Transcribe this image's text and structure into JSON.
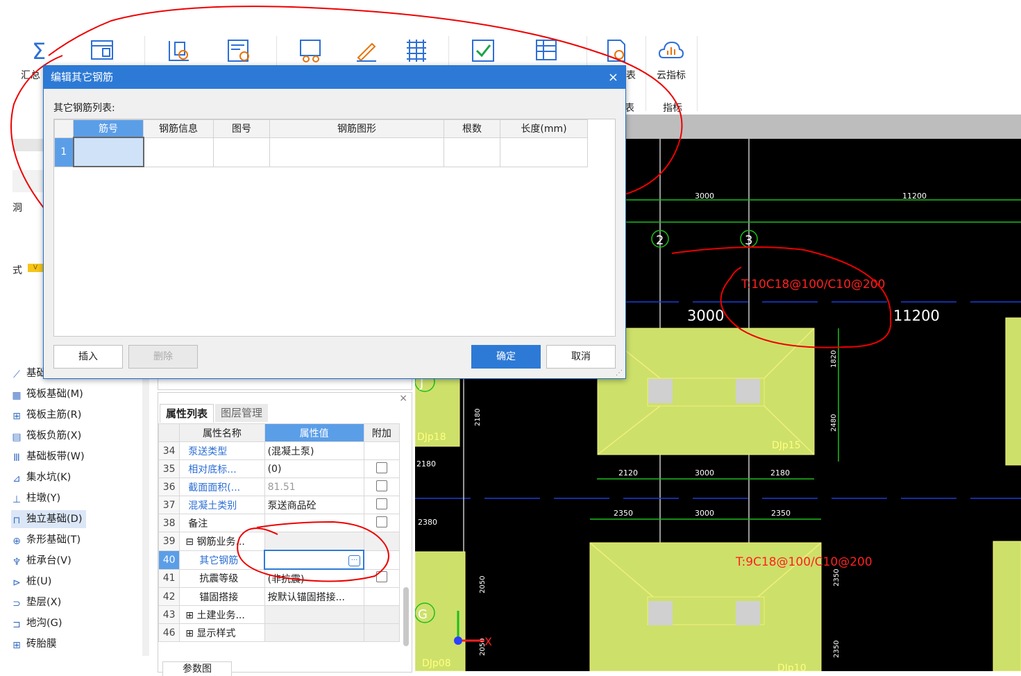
{
  "ribbon": {
    "labels": {
      "summary": "汇总",
      "report": "表",
      "cloud_index": "云指标",
      "group_index": "指标",
      "group_left": "表"
    }
  },
  "left_panel": {
    "stub_labels": [
      "洞",
      "式"
    ],
    "tag": "V",
    "items": [
      {
        "label": "基础",
        "icon": "foundation-icon"
      },
      {
        "label": "筏板基础(M)",
        "icon": "raft-icon"
      },
      {
        "label": "筏板主筋(R)",
        "icon": "raft-main-rebar-icon"
      },
      {
        "label": "筏板负筋(X)",
        "icon": "raft-negative-rebar-icon"
      },
      {
        "label": "基础板带(W)",
        "icon": "foundation-strip-icon"
      },
      {
        "label": "集水坑(K)",
        "icon": "sump-icon"
      },
      {
        "label": "柱墩(Y)",
        "icon": "column-pier-icon"
      },
      {
        "label": "独立基础(D)",
        "icon": "isolated-footing-icon"
      },
      {
        "label": "条形基础(T)",
        "icon": "strip-footing-icon"
      },
      {
        "label": "桩承台(V)",
        "icon": "pile-cap-icon"
      },
      {
        "label": "桩(U)",
        "icon": "pile-icon"
      },
      {
        "label": "垫层(X)",
        "icon": "cushion-icon"
      },
      {
        "label": "地沟(G)",
        "icon": "trench-icon"
      },
      {
        "label": "砖胎膜",
        "icon": "brick-mold-icon"
      }
    ]
  },
  "property_panel": {
    "tabs": [
      "属性列表",
      "图层管理"
    ],
    "headers": [
      "属性名称",
      "属性值",
      "附加"
    ],
    "rows": [
      {
        "num": "34",
        "name": "泵送类型",
        "value": "(混凝土泵)"
      },
      {
        "num": "35",
        "name": "相对底标...",
        "value": "(0)"
      },
      {
        "num": "36",
        "name": "截面面积(...",
        "value": "81.51"
      },
      {
        "num": "37",
        "name": "混凝土类别",
        "value": "泵送商品砼"
      },
      {
        "num": "38",
        "name": "备注",
        "value": ""
      },
      {
        "num": "39",
        "name": "钢筋业务...",
        "value": ""
      },
      {
        "num": "40",
        "name": "其它钢筋",
        "value": ""
      },
      {
        "num": "41",
        "name": "抗震等级",
        "value": "(非抗震)"
      },
      {
        "num": "42",
        "name": "锚固搭接",
        "value": "按默认锚固搭接..."
      },
      {
        "num": "43",
        "name": "土建业务...",
        "value": ""
      },
      {
        "num": "46",
        "name": "显示样式",
        "value": ""
      }
    ],
    "bottom_tab": "参数图",
    "ellipsis": "···",
    "close": "×"
  },
  "dialog": {
    "title": "编辑其它钢筋",
    "close": "×",
    "list_label": "其它钢筋列表:",
    "columns": [
      "筋号",
      "钢筋信息",
      "图号",
      "钢筋图形",
      "根数",
      "长度(mm)"
    ],
    "rows": [
      {
        "index": "1"
      }
    ],
    "buttons": {
      "insert": "插入",
      "delete": "删除",
      "ok": "确定",
      "cancel": "取消"
    }
  },
  "cad": {
    "grid_labels": [
      "2",
      "3"
    ],
    "axis_labels": [
      "J",
      "G"
    ],
    "dims_top": [
      "3000",
      "11200"
    ],
    "dims_mid": [
      "3000",
      "11200"
    ],
    "dims_row1": [
      "2120",
      "3000",
      "2180"
    ],
    "dims_row2": [
      "2350",
      "3000",
      "2350"
    ],
    "dims_vert": [
      "1820",
      "2480",
      "2180",
      "2180",
      "2380",
      "2050",
      "2050",
      "2350",
      "2350"
    ],
    "rebar_notes": [
      "T:10C18@100/C10@200",
      "T:9C18@100/C10@200"
    ],
    "footings": [
      "DJp15",
      "DJp18",
      "DJp08",
      "DJp10"
    ],
    "ucs": "X"
  }
}
